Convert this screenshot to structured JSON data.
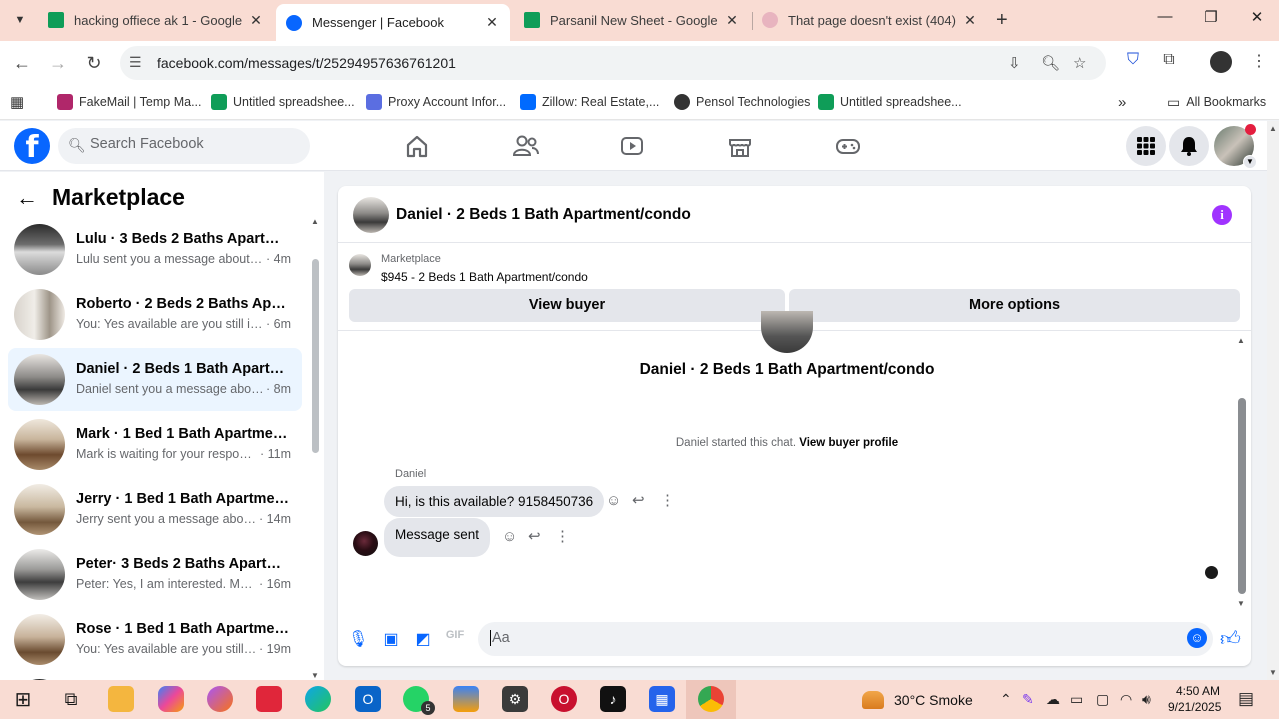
{
  "browser": {
    "tabs": [
      {
        "title": "hacking offiece ak 1 - Google Sh",
        "active": false,
        "favicon_color": "#0f9d58"
      },
      {
        "title": "Messenger | Facebook",
        "active": true,
        "favicon_color": "#0866ff"
      },
      {
        "title": "Parsanil New Sheet - Google Sh",
        "active": false,
        "favicon_color": "#0f9d58"
      },
      {
        "title": "That page doesn't exist (404) - F",
        "active": false,
        "favicon_color": "#e48a9a"
      }
    ],
    "url": "facebook.com/messages/t/25294957636761201",
    "bookmarks": [
      {
        "label": "FakeMail | Temp Ma...",
        "color": "#b0276a"
      },
      {
        "label": "Untitled spreadshee...",
        "color": "#0f9d58"
      },
      {
        "label": "Proxy Account Infor...",
        "color": "#5b6ee1"
      },
      {
        "label": "Zillow: Real Estate,...",
        "color": "#006aff"
      },
      {
        "label": "Pensol Technologies",
        "color": "#333333"
      },
      {
        "label": "Untitled spreadshee...",
        "color": "#0f9d58"
      }
    ],
    "all_bookmarks_label": "All Bookmarks"
  },
  "facebook": {
    "search_placeholder": "Search Facebook",
    "logo_letter": "f"
  },
  "marketplace": {
    "title": "Marketplace",
    "conversations": [
      {
        "name": "Lulu · 3 Beds 2 Baths Apartment...",
        "snippet": "Lulu sent you a message about yo...",
        "time": "4m",
        "active": false
      },
      {
        "name": "Roberto · 2 Beds 2 Baths Apart...",
        "snippet": "You: Yes available are you still inter...",
        "time": "6m",
        "active": false
      },
      {
        "name": "Daniel · 2 Beds 1 Bath Apartmen...",
        "snippet": "Daniel sent you a message about ...",
        "time": "8m",
        "active": true
      },
      {
        "name": "Mark · 1 Bed 1 Bath Apartment/...",
        "snippet": "Mark is waiting for your response.",
        "time": "11m",
        "active": false
      },
      {
        "name": "Jerry · 1 Bed 1 Bath Apartment/c...",
        "snippet": "Jerry sent you a message about y...",
        "time": "14m",
        "active": false
      },
      {
        "name": "Peter· 3 Beds 2 Baths Apartmen...",
        "snippet": "Peter: Yes, I am interested. My nu...",
        "time": "16m",
        "active": false
      },
      {
        "name": "Rose · 1 Bed 1 Bath Apartment/c...",
        "snippet": "You: Yes available are you still int...",
        "time": "19m",
        "active": false
      }
    ]
  },
  "chat": {
    "title": "Daniel · 2 Beds 1 Bath Apartment/condo",
    "marketplace_label": "Marketplace",
    "listing": "$945 - 2 Beds 1 Bath Apartment/condo",
    "view_buyer": "View buyer",
    "more_options": "More options",
    "thread_title": "Daniel · 2 Beds 1 Bath Apartment/condo",
    "started_text": "Daniel started this chat.",
    "view_profile": "View buyer profile",
    "sender_name": "Daniel",
    "messages": [
      {
        "text": "Hi, is this available? 9158450736"
      },
      {
        "text": "Message sent"
      }
    ],
    "composer_placeholder": "Aa"
  },
  "taskbar": {
    "weather": "30°C  Smoke",
    "time": "4:50 AM",
    "date": "9/21/2025",
    "whatsapp_badge": "5"
  }
}
